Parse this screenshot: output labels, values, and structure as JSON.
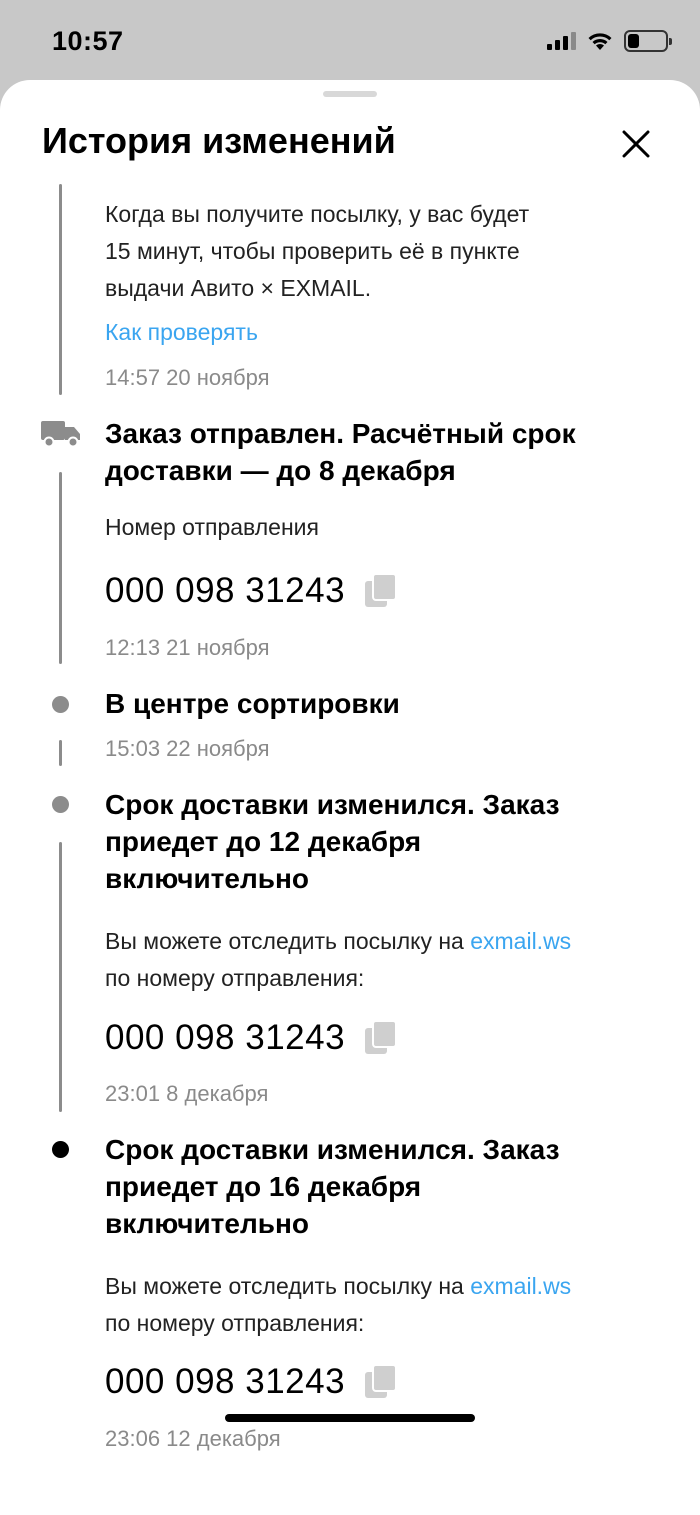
{
  "status_bar": {
    "time": "10:57"
  },
  "sheet": {
    "title": "История изменений"
  },
  "events": {
    "e0": {
      "text_line1": "Когда вы получите посылку, у вас будет",
      "text_line2": "15 минут, чтобы проверить её в пункте",
      "text_line3": "выдачи Авито × EXMAIL.",
      "link": "Как проверять",
      "time": "14:57 20 ноября"
    },
    "e1": {
      "title_line1": "Заказ отправлен. Расчётный срок",
      "title_line2": "доставки — до 8 декабря",
      "label": "Номер отправления",
      "tracking": "000 098 31243",
      "time": "12:13 21 ноября"
    },
    "e2": {
      "title": "В центре сортировки",
      "time": "15:03 22 ноября"
    },
    "e3": {
      "title_line1": "Срок доставки изменился. Заказ",
      "title_line2": "приедет до 12 декабря",
      "title_line3": "включительно",
      "text_prefix": "Вы можете отследить посылку на ",
      "text_link": "exmail.ws",
      "text_line2": "по номеру отправления:",
      "tracking": "000 098 31243",
      "time": "23:01 8 декабря"
    },
    "e4": {
      "title_line1": "Срок доставки изменился. Заказ",
      "title_line2": "приедет до 16 декабря",
      "title_line3": "включительно",
      "text_prefix": "Вы можете отследить посылку на ",
      "text_link": "exmail.ws",
      "text_line2": "по номеру отправления:",
      "tracking": "000 098 31243",
      "time": "23:06 12 декабря"
    }
  },
  "icons": [
    "signal-icon",
    "wifi-icon",
    "battery-icon",
    "close-icon",
    "truck-icon",
    "copy-icon"
  ],
  "colors": {
    "link": "#3aa5f0",
    "muted": "#8a8a8a",
    "rail": "#8c8c8c"
  }
}
